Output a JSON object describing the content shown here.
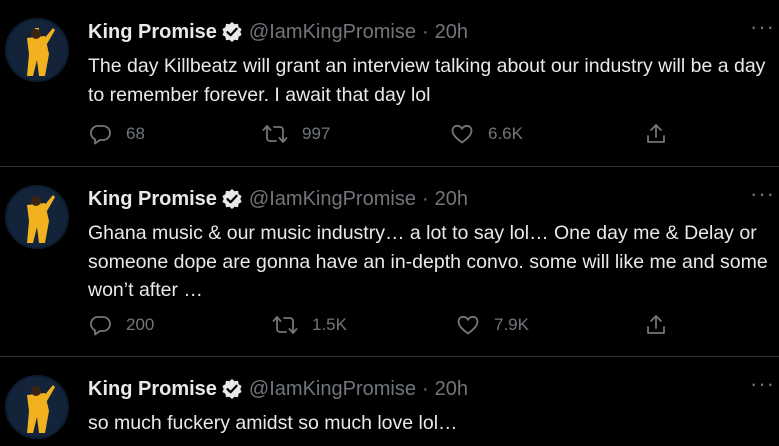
{
  "tweets": [
    {
      "name": "King Promise",
      "handle": "@IamKingPromise",
      "separator": "·",
      "time": "20h",
      "more": "···",
      "text": "The day Killbeatz will grant an interview talking about our industry will be a day to remember forever. I await that day lol",
      "replies": "68",
      "retweets": "997",
      "likes": "6.6K"
    },
    {
      "name": "King Promise",
      "handle": "@IamKingPromise",
      "separator": "·",
      "time": "20h",
      "more": "···",
      "text": "Ghana music & our music industry… a lot to say lol… One day me & Delay or someone dope are gonna have an in-depth convo. some will like me and some won’t after …",
      "replies": "200",
      "retweets": "1.5K",
      "likes": "7.9K"
    },
    {
      "name": "King Promise",
      "handle": "@IamKingPromise",
      "separator": "·",
      "time": "20h",
      "more": "···",
      "text": "so much fuckery amidst so much love lol…"
    }
  ],
  "icons": {
    "verified": "verified-badge-icon",
    "reply": "reply-icon",
    "retweet": "retweet-icon",
    "like": "heart-icon",
    "share": "share-icon",
    "more": "more-icon"
  },
  "colors": {
    "background": "#000000",
    "text": "#e7e9ea",
    "muted": "#71767b",
    "divider": "#2f3336",
    "avatar_bg": "#0d1b2e",
    "avatar_figure": "#f2b21f"
  }
}
